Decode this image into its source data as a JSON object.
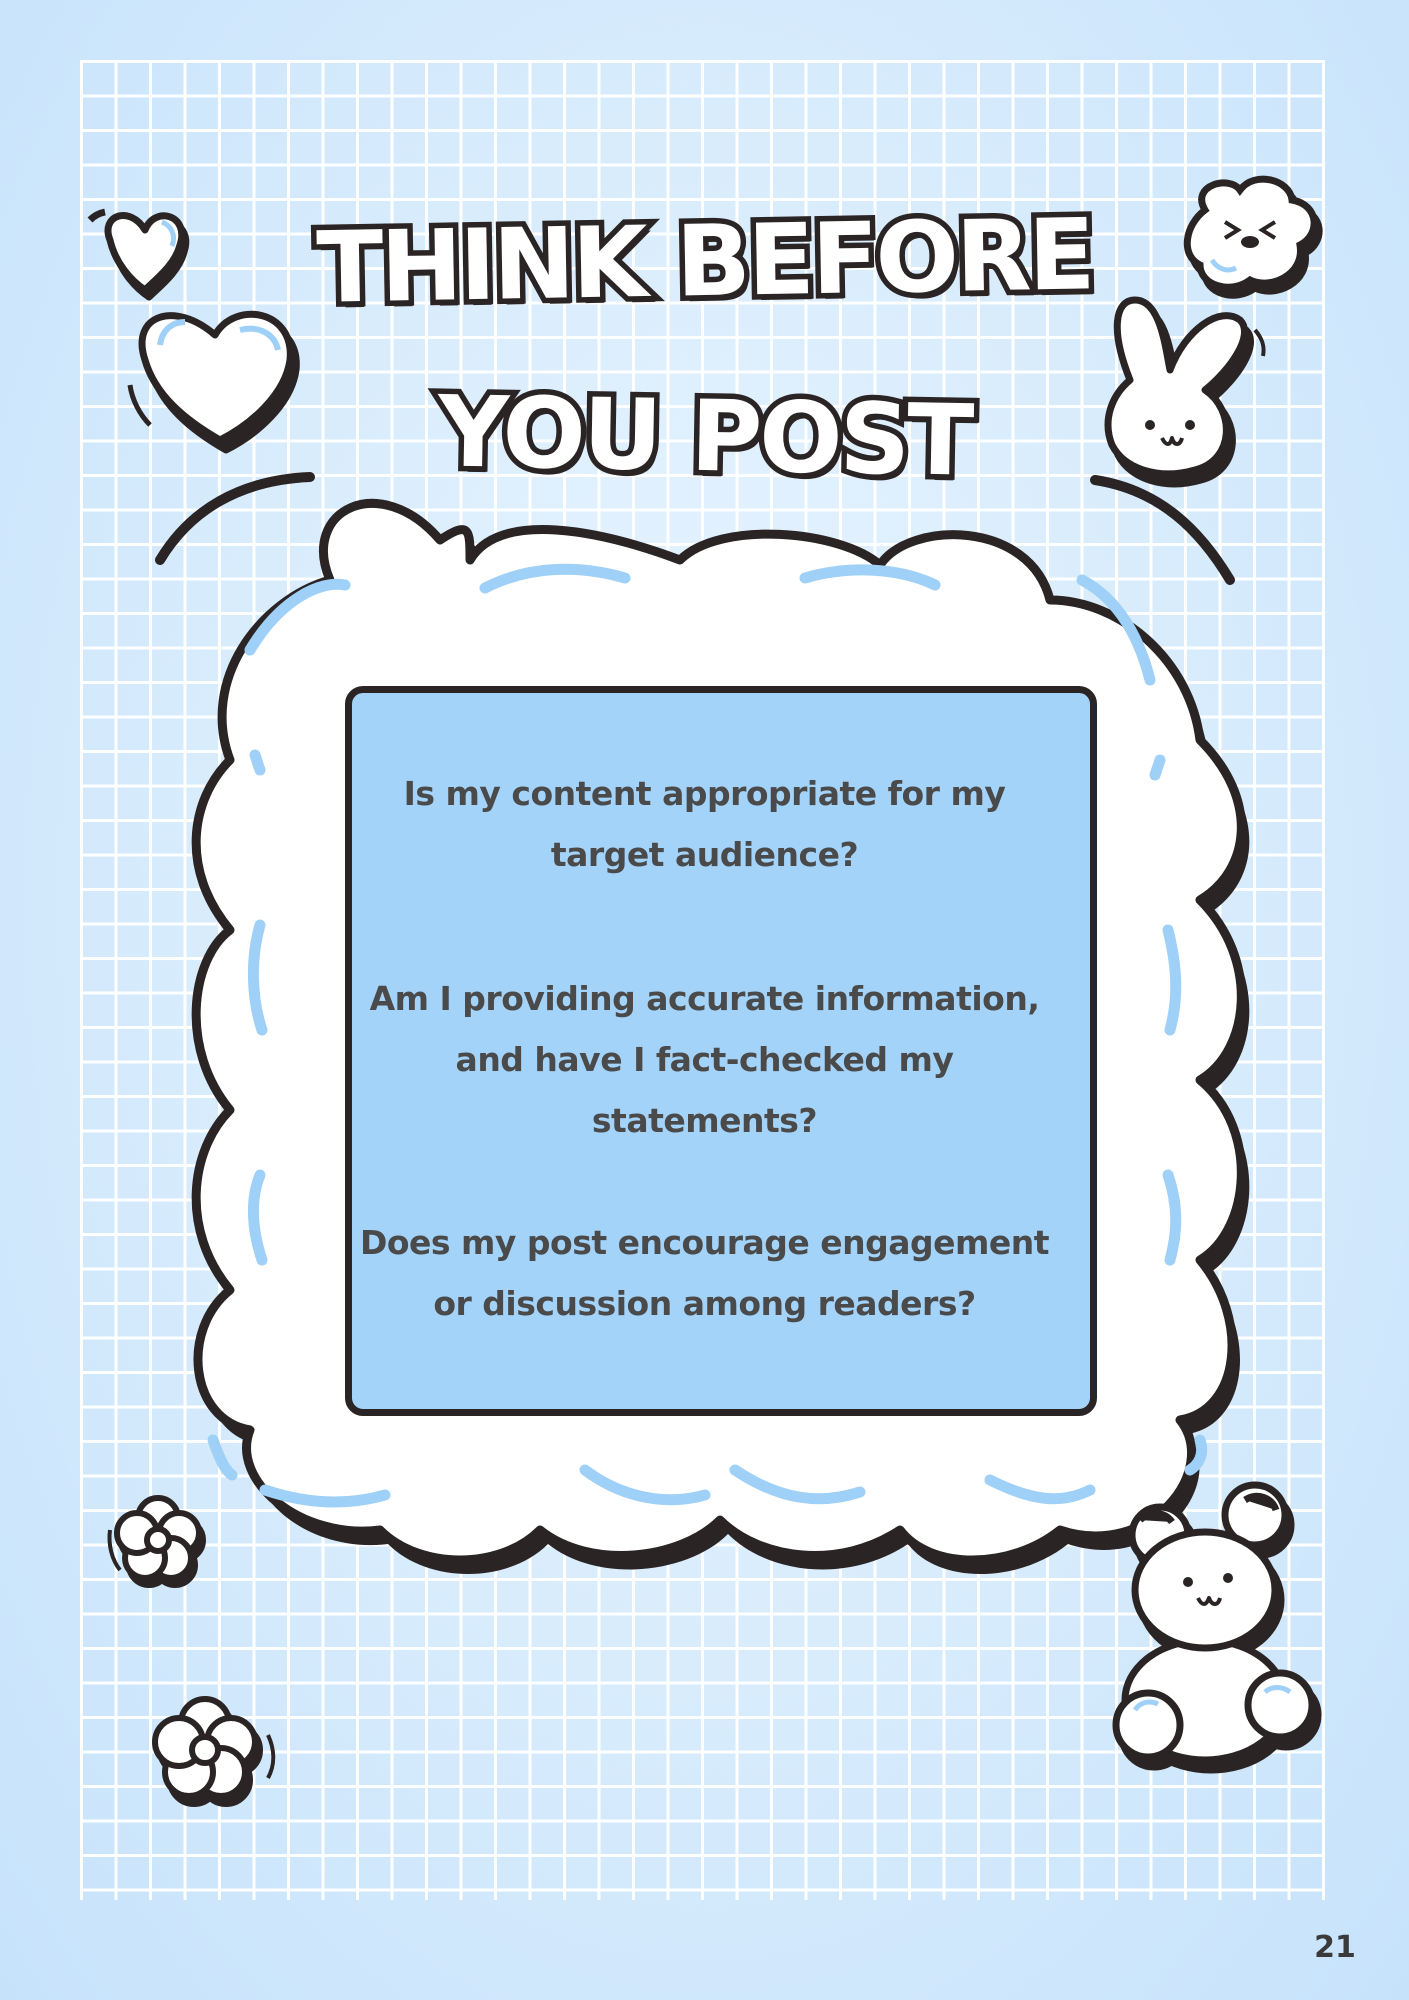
{
  "title": {
    "line1": "THINK BEFORE",
    "line2": "YOU POST"
  },
  "questions": [
    {
      "line1": "Is my content appropriate for my",
      "line2": "target audience?"
    },
    {
      "line1": "Am I providing accurate information,",
      "line2": "and have I fact-checked my",
      "line3": "statements?"
    },
    {
      "line1": "Does my post encourage engagement",
      "line2": "or discussion among readers?"
    }
  ],
  "page_number": "21",
  "colors": {
    "background": "#d6ebfc",
    "card": "#a3d3f9",
    "outline": "#2b2425",
    "cloud": "#ffffff",
    "accent_stroke": "#9fd0f7",
    "question_text": "#4a4a4a"
  },
  "icons": [
    "heart-icon",
    "bunny-icon",
    "face-icon",
    "flower-icon",
    "teddy-bear-icon"
  ]
}
